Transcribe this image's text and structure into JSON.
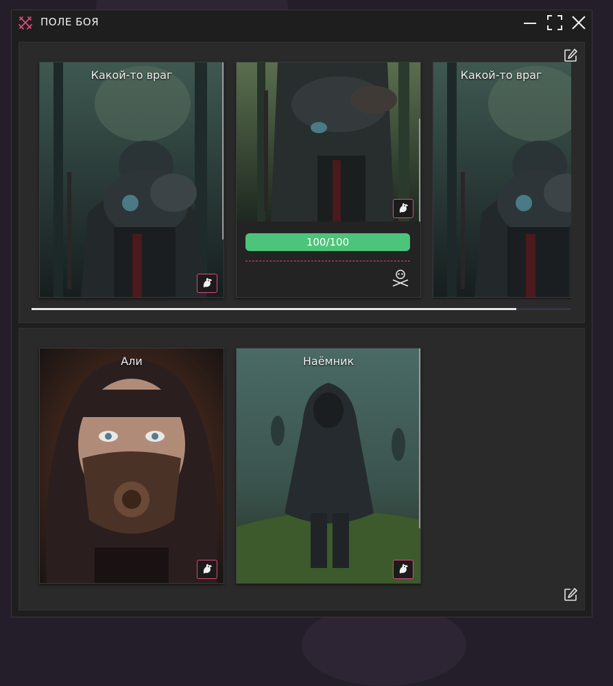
{
  "window": {
    "title": "ПОЛЕ БОЯ",
    "controls": [
      "minimize-icon",
      "maximize-icon",
      "close-icon"
    ]
  },
  "enemy_zone": {
    "edit_icon": "edit-icon",
    "cards": [
      {
        "name": "Какой-то враг",
        "badge_icon": "dragon-icon"
      },
      {
        "name": "",
        "badge_icon": "dragon-icon",
        "hp_text": "100/100",
        "hp_fraction": 1.0,
        "action_icon": "skull-crossbones-icon"
      },
      {
        "name": "Какой-то враг"
      }
    ],
    "scroll_fraction": 0.9
  },
  "party_zone": {
    "edit_icon": "edit-icon",
    "cards": [
      {
        "name": "Али",
        "badge_icon": "dragon-icon"
      },
      {
        "name": "Наёмник",
        "badge_icon": "dragon-icon"
      }
    ]
  },
  "colors": {
    "accent": "#e04a7c",
    "hp": "#4cc47a",
    "window_bg": "#1e1e1e",
    "panel_bg": "#2a2a2a",
    "page_bg": "#241d2a"
  }
}
